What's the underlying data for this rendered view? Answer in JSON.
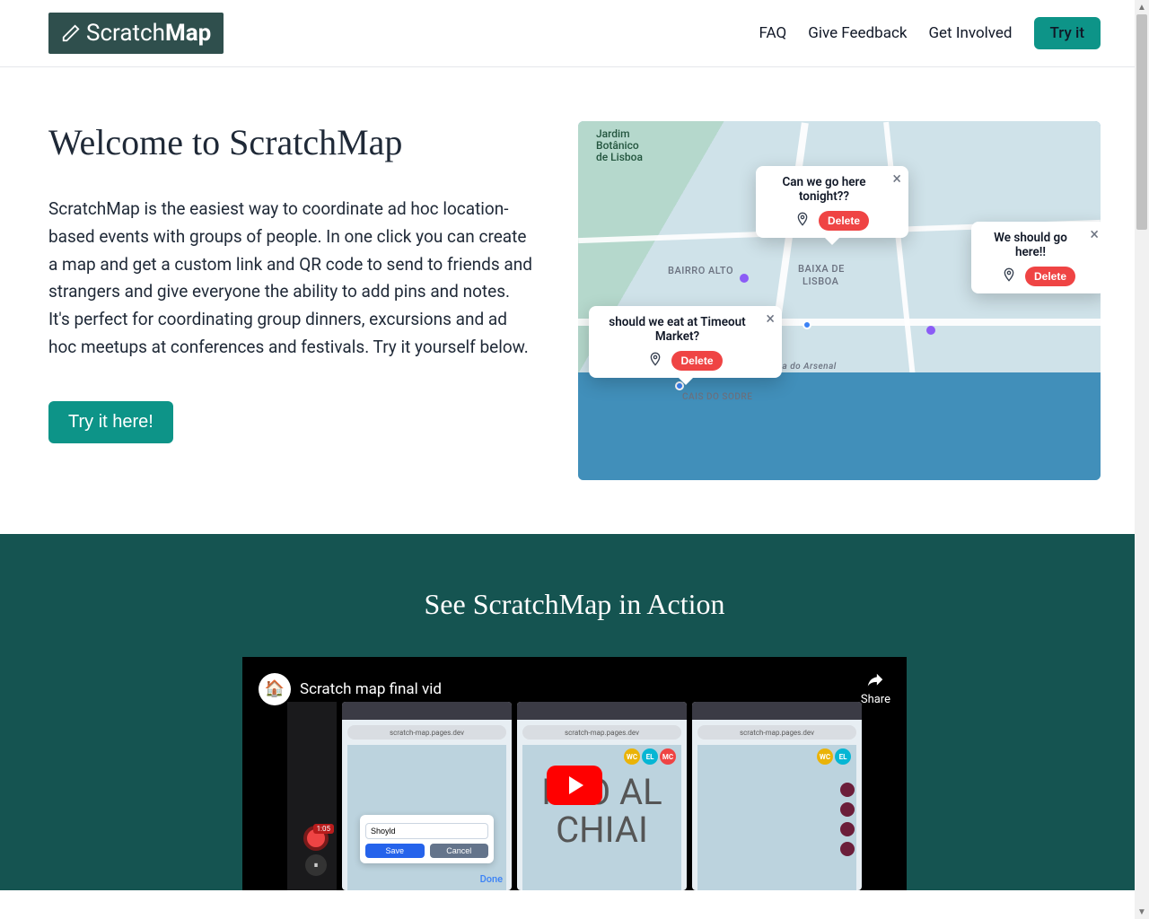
{
  "header": {
    "brand_plain": "Scratch",
    "brand_bold": "Map",
    "nav": {
      "faq": "FAQ",
      "feedback": "Give Feedback",
      "involved": "Get Involved"
    },
    "try_btn": "Try it"
  },
  "hero": {
    "title": "Welcome to ScratchMap",
    "desc": "ScratchMap is the easiest way to coordinate ad hoc location-based events with groups of people. In one click you can create a map and get a custom link and QR code to send to friends and strangers and give everyone the ability to add pins and notes. It's perfect for coordinating group dinners, excursions and ad hoc meetups at conferences and festivals. Try it yourself below.",
    "cta": "Try it here!"
  },
  "map": {
    "parkLabel": "Jardim\nBotânico\nde Lisboa",
    "hoods": {
      "bairro": "BAIRRO ALTO",
      "baixa1": "BAIXA DE",
      "baixa2": "LISBOA",
      "cais": "CAIS DO SODRE",
      "arsenal": "Rua do Arsenal"
    },
    "popups": [
      {
        "msg": "Can we go here tonight??",
        "delete": "Delete"
      },
      {
        "msg": "We should go here!!",
        "delete": "Delete"
      },
      {
        "msg": "should we eat at Timeout Market?",
        "delete": "Delete"
      }
    ]
  },
  "action": {
    "title": "See ScratchMap in Action",
    "video_title": "Scratch map final vid",
    "share": "Share",
    "addr": "scratch-map.pages.dev",
    "rec_time": "1:05",
    "dialog": {
      "value": "Shoyld",
      "save": "Save",
      "cancel": "Cancel"
    },
    "done": "Done",
    "chips": {
      "wc": "WC",
      "el": "EL",
      "mc": "MC"
    },
    "bigtext1": "RRO AL",
    "bigtext2": "CHIAI"
  }
}
